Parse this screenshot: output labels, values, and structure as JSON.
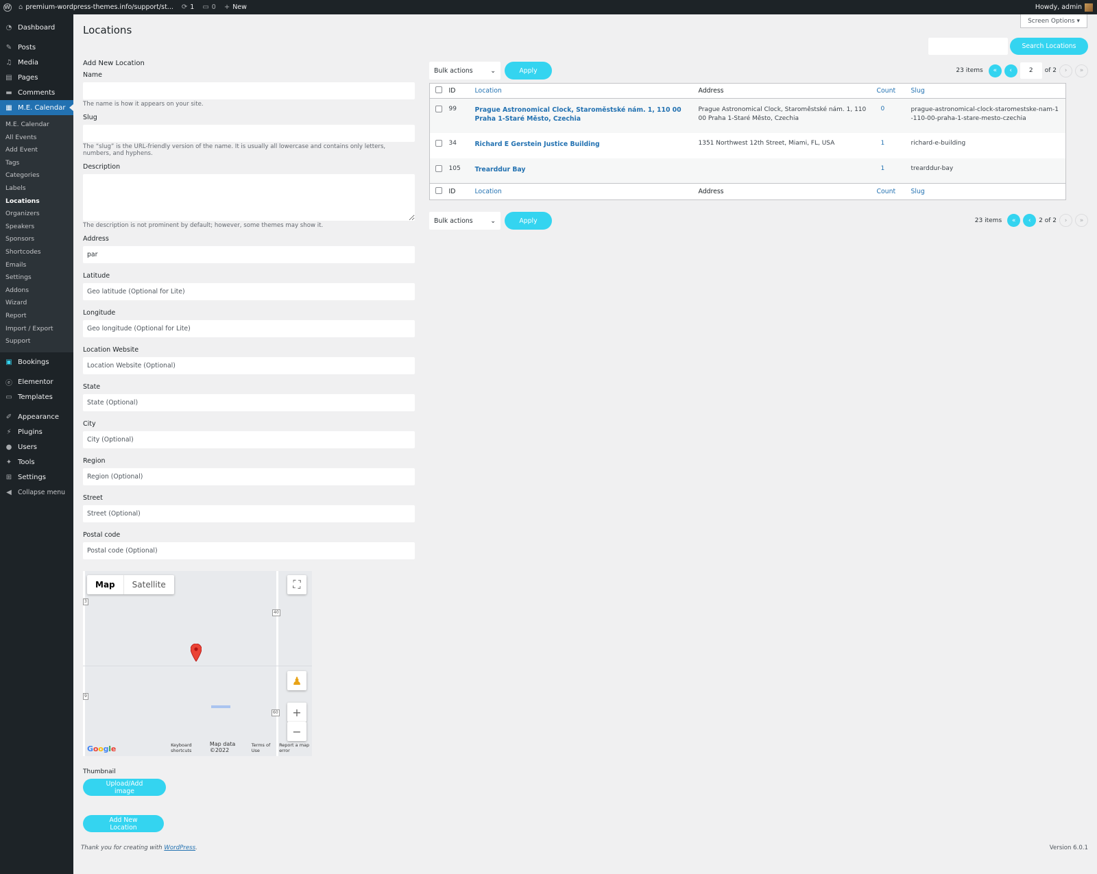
{
  "adminbar": {
    "site": "premium-wordpress-themes.info/support/st...",
    "updates": "1",
    "comments": "0",
    "new": "New",
    "howdy": "Howdy, admin"
  },
  "menu": {
    "dashboard": "Dashboard",
    "posts": "Posts",
    "media": "Media",
    "pages": "Pages",
    "comments": "Comments",
    "mecalendar": "M.E. Calendar",
    "sub": [
      "M.E. Calendar",
      "All Events",
      "Add Event",
      "Tags",
      "Categories",
      "Labels",
      "Locations",
      "Organizers",
      "Speakers",
      "Sponsors",
      "Shortcodes",
      "Emails",
      "Settings",
      "Addons",
      "Wizard",
      "Report",
      "Import / Export",
      "Support"
    ],
    "bookings": "Bookings",
    "elementor": "Elementor",
    "templates": "Templates",
    "appearance": "Appearance",
    "plugins": "Plugins",
    "users": "Users",
    "tools": "Tools",
    "settings": "Settings",
    "collapse": "Collapse menu"
  },
  "page": {
    "title": "Locations",
    "screen_options": "Screen Options ▾"
  },
  "form": {
    "heading": "Add New Location",
    "name_label": "Name",
    "name_help": "The name is how it appears on your site.",
    "slug_label": "Slug",
    "slug_help": "The “slug” is the URL-friendly version of the name. It is usually all lowercase and contains only letters, numbers, and hyphens.",
    "description_label": "Description",
    "description_help": "The description is not prominent by default; however, some themes may show it.",
    "address_label": "Address",
    "address_value": "par",
    "latitude_label": "Latitude",
    "latitude_placeholder": "Geo latitude (Optional for Lite)",
    "longitude_label": "Longitude",
    "longitude_placeholder": "Geo longitude (Optional for Lite)",
    "website_label": "Location Website",
    "website_placeholder": "Location Website (Optional)",
    "state_label": "State",
    "state_placeholder": "State (Optional)",
    "city_label": "City",
    "city_placeholder": "City (Optional)",
    "region_label": "Region",
    "region_placeholder": "Region (Optional)",
    "street_label": "Street",
    "street_placeholder": "Street (Optional)",
    "postal_label": "Postal code",
    "postal_placeholder": "Postal code (Optional)",
    "thumbnail_label": "Thumbnail",
    "upload_button": "Upload/Add image",
    "submit_button": "Add New Location"
  },
  "map": {
    "type_map": "Map",
    "type_satellite": "Satellite",
    "shields": [
      "3",
      "40",
      "9",
      "60"
    ],
    "footer_shortcuts": "Keyboard shortcuts",
    "footer_data": "Map data ©2022",
    "footer_terms": "Terms of Use",
    "footer_report": "Report a map error",
    "icons": {
      "fullscreen": "fullscreen-icon",
      "pegman": "pegman-icon",
      "zoom_in": "zoom-in-icon",
      "zoom_out": "zoom-out-icon",
      "pin": "map-pin-icon"
    }
  },
  "list": {
    "search_button": "Search Locations",
    "bulk_actions": "Bulk actions",
    "apply": "Apply",
    "items": "23 items",
    "page_input": "2",
    "of_pages": "of 2",
    "bottom_page": "2 of 2",
    "columns": {
      "id": "ID",
      "location": "Location",
      "address": "Address",
      "count": "Count",
      "slug": "Slug"
    },
    "rows": [
      {
        "id": "99",
        "location": "Prague Astronomical Clock, Staroměstské nám. 1, 110 00 Praha 1-Staré Město, Czechia",
        "address": "Prague Astronomical Clock, Staroměstské nám. 1, 110 00 Praha 1-Staré Město, Czechia",
        "count": "0",
        "slug": "prague-astronomical-clock-staromestske-nam-1-110-00-praha-1-stare-mesto-czechia"
      },
      {
        "id": "34",
        "location": "Richard E Gerstein Justice Building",
        "address": "1351 Northwest 12th Street, Miami, FL, USA",
        "count": "1",
        "slug": "richard-e-building"
      },
      {
        "id": "105",
        "location": "Trearddur Bay",
        "address": "",
        "count": "1",
        "slug": "trearddur-bay"
      }
    ]
  },
  "footer": {
    "thanks": "Thank you for creating with ",
    "wp_link": "WordPress",
    "period": ".",
    "version": "Version 6.0.1"
  },
  "colors": {
    "accent": "#34d4f0",
    "admin_dark": "#1d2327",
    "link": "#2271b1",
    "menu_current": "#2271b1"
  }
}
